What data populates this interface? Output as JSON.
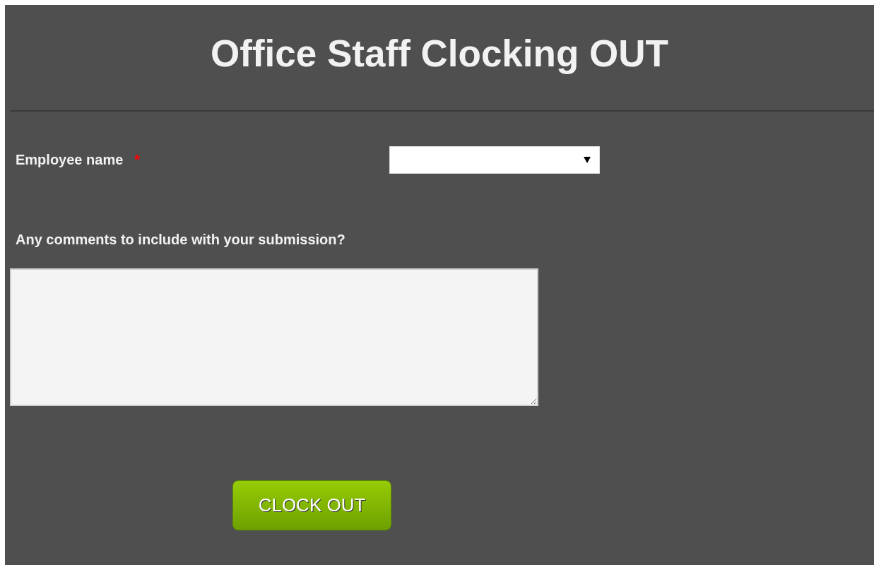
{
  "form": {
    "title": "Office Staff Clocking OUT",
    "fields": [
      {
        "kind": "select",
        "label": "Employee name",
        "required_mark": "*"
      },
      {
        "kind": "textarea",
        "label": "Any comments to include with your submission?"
      }
    ],
    "submit_button": "CLOCK OUT"
  }
}
